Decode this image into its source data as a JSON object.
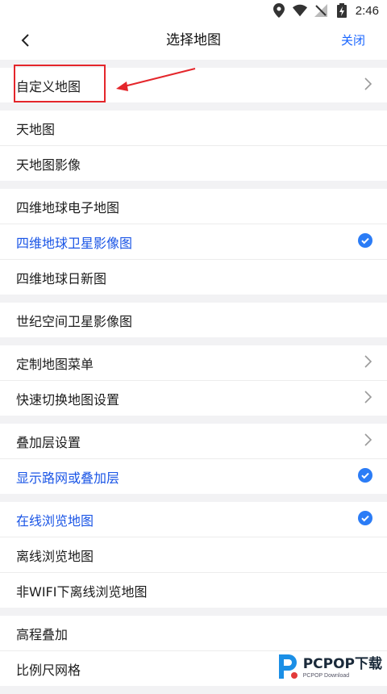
{
  "status_bar": {
    "time": "2:46"
  },
  "header": {
    "title": "选择地图",
    "close_label": "关闭"
  },
  "groups": [
    [
      {
        "label": "自定义地图",
        "accessory": "chevron",
        "active": false
      }
    ],
    [
      {
        "label": "天地图",
        "accessory": "none",
        "active": false
      },
      {
        "label": "天地图影像",
        "accessory": "none",
        "active": false
      }
    ],
    [
      {
        "label": "四维地球电子地图",
        "accessory": "none",
        "active": false
      },
      {
        "label": "四维地球卫星影像图",
        "accessory": "check",
        "active": true
      },
      {
        "label": "四维地球日新图",
        "accessory": "none",
        "active": false
      }
    ],
    [
      {
        "label": "世纪空间卫星影像图",
        "accessory": "none",
        "active": false
      }
    ],
    [
      {
        "label": "定制地图菜单",
        "accessory": "chevron",
        "active": false
      },
      {
        "label": "快速切换地图设置",
        "accessory": "chevron",
        "active": false
      }
    ],
    [
      {
        "label": "叠加层设置",
        "accessory": "chevron",
        "active": false
      },
      {
        "label": "显示路网或叠加层",
        "accessory": "check",
        "active": true
      }
    ],
    [
      {
        "label": "在线浏览地图",
        "accessory": "check",
        "active": true
      },
      {
        "label": "离线浏览地图",
        "accessory": "none",
        "active": false
      },
      {
        "label": "非WIFI下离线浏览地图",
        "accessory": "none",
        "active": false
      }
    ],
    [
      {
        "label": "高程叠加",
        "accessory": "none",
        "active": false
      },
      {
        "label": "比例尺网格",
        "accessory": "none",
        "active": false
      }
    ]
  ],
  "watermark": {
    "main": "PCPOP下载",
    "sub": "PCPOP Download"
  },
  "colors": {
    "accent": "#1a55e6",
    "check": "#2b7cf6",
    "annotation": "#e4262b"
  }
}
